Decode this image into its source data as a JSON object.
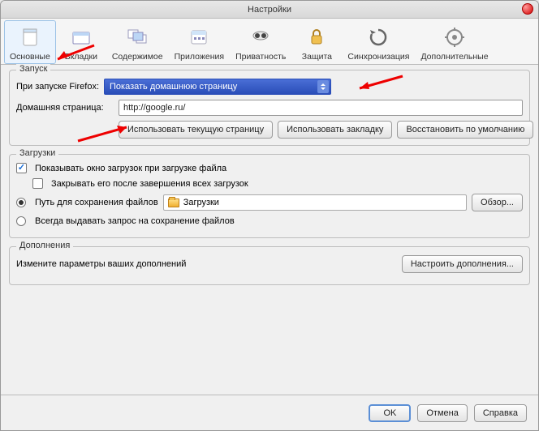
{
  "title": "Настройки",
  "toolbar": [
    {
      "label": "Основные",
      "icon": "general"
    },
    {
      "label": "Вкладки",
      "icon": "tabs"
    },
    {
      "label": "Содержимое",
      "icon": "content"
    },
    {
      "label": "Приложения",
      "icon": "apps"
    },
    {
      "label": "Приватность",
      "icon": "privacy"
    },
    {
      "label": "Защита",
      "icon": "security"
    },
    {
      "label": "Синхронизация",
      "icon": "sync"
    },
    {
      "label": "Дополнительные",
      "icon": "advanced"
    }
  ],
  "startup": {
    "legend": "Запуск",
    "when_label": "При запуске Firefox:",
    "when_value": "Показать домашнюю страницу",
    "home_label": "Домашняя страница:",
    "home_value": "http://google.ru/",
    "btn_current": "Использовать текущую страницу",
    "btn_bookmark": "Использовать закладку",
    "btn_default": "Восстановить по умолчанию"
  },
  "downloads": {
    "legend": "Загрузки",
    "show_window": "Показывать окно загрузок при загрузке файла",
    "close_after": "Закрывать его после завершения всех загрузок",
    "save_path": "Путь для сохранения файлов",
    "folder_name": "Загрузки",
    "browse": "Обзор...",
    "ask_always": "Всегда выдавать запрос на сохранение файлов"
  },
  "addons": {
    "legend": "Дополнения",
    "text": "Измените параметры ваших дополнений",
    "btn": "Настроить дополнения..."
  },
  "footer": {
    "ok": "OK",
    "cancel": "Отмена",
    "help": "Справка"
  }
}
